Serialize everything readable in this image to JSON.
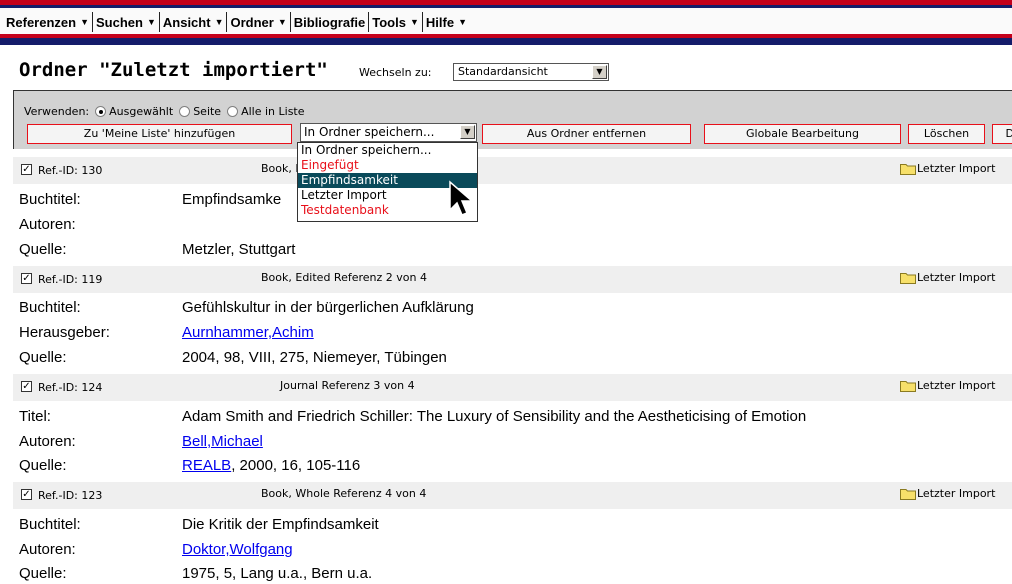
{
  "menu": [
    {
      "label": "Referenzen",
      "caret": "▼"
    },
    {
      "label": "Suchen",
      "caret": "▼"
    },
    {
      "label": "Ansicht",
      "caret": "▼"
    },
    {
      "label": "Ordner",
      "caret": "▼"
    },
    {
      "label": "Bibliografie",
      "caret": ""
    },
    {
      "label": "Tools",
      "caret": "▼"
    },
    {
      "label": "Hilfe",
      "caret": "▼"
    }
  ],
  "title": "Ordner \"Zuletzt importiert\"",
  "switch": {
    "label": "Wechseln zu:",
    "value": "Standardansicht"
  },
  "toolbar": {
    "use_label": "Verwenden:",
    "radio_selected": "Ausgewählt",
    "radio_page": "Seite",
    "radio_all": "Alle in Liste",
    "add_label": "Zu 'Meine Liste' hinzufügen",
    "folder_select": "In Ordner speichern...",
    "remove_label": "Aus Ordner entfernen",
    "global_edit_label": "Globale Bearbeitung",
    "delete_label": "Löschen",
    "more_label": "D"
  },
  "dropdown": {
    "options": [
      {
        "label": "In Ordner speichern...",
        "style": "normal"
      },
      {
        "label": "Eingefügt",
        "style": "red"
      },
      {
        "label": "Empfindsamkeit",
        "style": "selected"
      },
      {
        "label": "Letzter Import",
        "style": "normal"
      },
      {
        "label": "Testdatenbank",
        "style": "red"
      }
    ]
  },
  "records": [
    {
      "ref": "Ref.-ID: 130",
      "type": "Book, E",
      "folder": "Letzter Import",
      "fields": [
        {
          "label": "Buchtitel:",
          "value": "Empfindsamke",
          "link": false,
          "extra": ""
        },
        {
          "label": "Autoren:",
          "value": "",
          "link": false,
          "extra": ""
        },
        {
          "label": "Quelle:",
          "value": "Metzler, Stuttgart",
          "link": false,
          "extra": ""
        }
      ]
    },
    {
      "ref": "Ref.-ID: 119",
      "type": "Book, Edited Referenz 2 von 4",
      "folder": "Letzter Import",
      "fields": [
        {
          "label": "Buchtitel:",
          "value": "Gefühlskultur in der bürgerlichen Aufklärung",
          "link": false,
          "extra": ""
        },
        {
          "label": "Herausgeber:",
          "value": "Aurnhammer,Achim",
          "link": true,
          "extra": ""
        },
        {
          "label": "Quelle:",
          "value": "2004, 98, VIII, 275, Niemeyer, Tübingen",
          "link": false,
          "extra": ""
        }
      ]
    },
    {
      "ref": "Ref.-ID: 124",
      "type": "Journal Referenz 3 von 4",
      "folder": "Letzter Import",
      "fields": [
        {
          "label": "Titel:",
          "value": "Adam Smith and Friedrich Schiller: The Luxury of Sensibility and the Aestheticising of Emotion",
          "link": false,
          "extra": ""
        },
        {
          "label": "Autoren:",
          "value": "Bell,Michael",
          "link": true,
          "extra": ""
        },
        {
          "label": "Quelle:",
          "value": "REALB",
          "link": true,
          "extra": ", 2000, 16, 105-116"
        }
      ]
    },
    {
      "ref": "Ref.-ID: 123",
      "type": "Book, Whole Referenz 4 von 4",
      "folder": "Letzter Import",
      "fields": [
        {
          "label": "Buchtitel:",
          "value": "Die Kritik der Empfindsamkeit",
          "link": false,
          "extra": ""
        },
        {
          "label": "Autoren:",
          "value": "Doktor,Wolfgang",
          "link": true,
          "extra": ""
        },
        {
          "label": "Quelle:",
          "value": "1975, 5, Lang u.a., Bern u.a.",
          "link": false,
          "extra": ""
        }
      ]
    }
  ]
}
